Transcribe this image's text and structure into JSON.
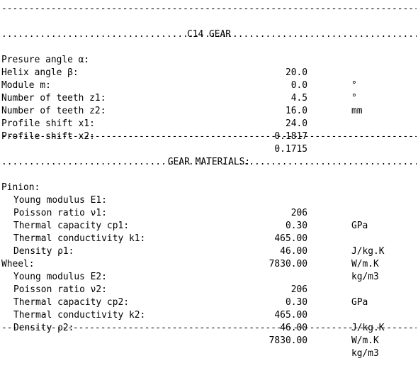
{
  "dash_rule": "--------------------------------------------------------------------------------",
  "dot_rule": "................................................................................",
  "gear": {
    "title": "C14 GEAR",
    "rows": [
      {
        "label": "Presure angle α:",
        "value": "20.0",
        "unit": "°"
      },
      {
        "label": "Helix angle β:",
        "value": "0.0",
        "unit": "°"
      },
      {
        "label": "Module m:",
        "value": "4.5",
        "unit": "mm"
      },
      {
        "label": "Number of teeth z1:",
        "value": "16.0",
        "unit": ""
      },
      {
        "label": "Number of teeth z2:",
        "value": "24.0",
        "unit": ""
      },
      {
        "label": "Profile shift x1:",
        "value": "0.1817",
        "unit": ""
      },
      {
        "label": "Profile shift x2:",
        "value": "0.1715",
        "unit": ""
      }
    ]
  },
  "materials": {
    "title": "GEAR MATERIALS:",
    "pinion": {
      "heading": "Pinion:",
      "rows": [
        {
          "label": "Young modulus E1:",
          "value": "206",
          "unit": "GPa"
        },
        {
          "label": "Poisson ratio ν1:",
          "value": "0.30",
          "unit": ""
        },
        {
          "label": "Thermal capacity cp1:",
          "value": "465.00",
          "unit": "J/kg.K"
        },
        {
          "label": "Thermal conductivity k1:",
          "value": "46.00",
          "unit": "W/m.K"
        },
        {
          "label": "Density ρ1:",
          "value": "7830.00",
          "unit": "kg/m3"
        }
      ]
    },
    "wheel": {
      "heading": "Wheel:",
      "rows": [
        {
          "label": "Young modulus E2:",
          "value": "206",
          "unit": "GPa"
        },
        {
          "label": "Poisson ratio ν2:",
          "value": "0.30",
          "unit": ""
        },
        {
          "label": "Thermal capacity cp2:",
          "value": "465.00",
          "unit": "J/kg.K"
        },
        {
          "label": "Thermal conductivity k2:",
          "value": "46.00",
          "unit": "W/m.K"
        },
        {
          "label": "Density ρ2:",
          "value": "7830.00",
          "unit": "kg/m3"
        }
      ]
    }
  }
}
